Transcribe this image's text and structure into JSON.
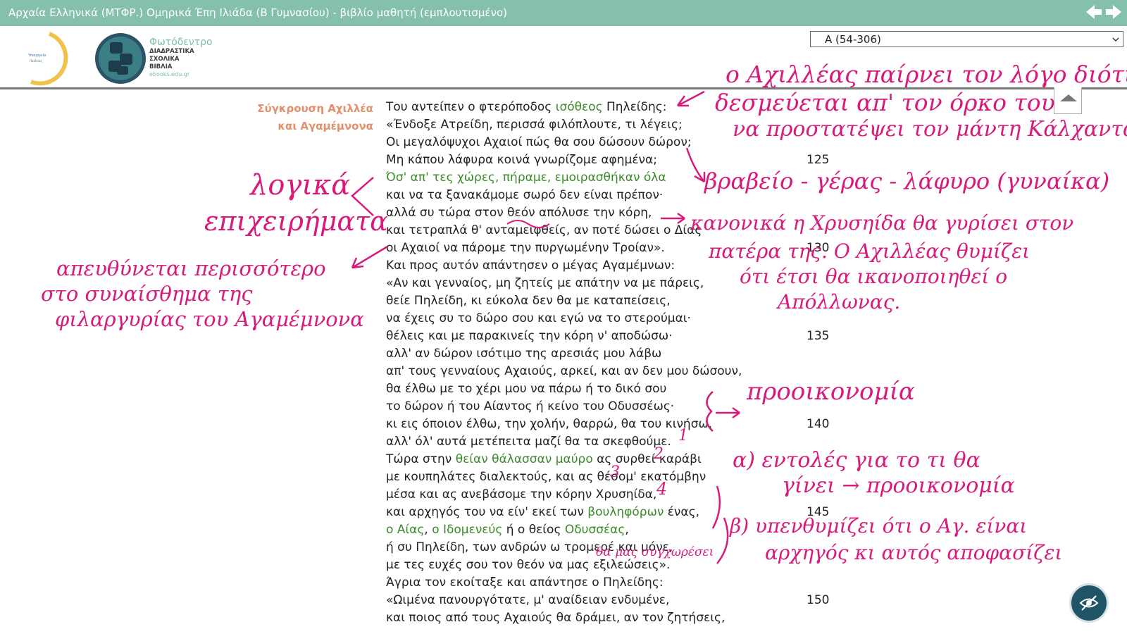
{
  "window": {
    "title": "Αρχαία Ελληνικά (ΜΤΦΡ.) Ομηρικά Έπη Ιλιάδα (Β Γυμνασίου) - βιβλίο μαθητή (εμπλουτισμένο)"
  },
  "header": {
    "brand_name": "Φωτόδεντρο",
    "brand_sub": [
      "ΔΙΑΔΡΑΣΤΙΚΑ",
      "ΣΧΟΛΙΚΑ",
      "ΒΙΒΛΙΑ"
    ],
    "brand_url": "ebooks.edu.gr",
    "selector_value": "Α (54-306)"
  },
  "section_title": [
    "Σύγκρουση Αχιλλέα",
    "και Αγαμέμνονα"
  ],
  "poem": {
    "lines": [
      [
        {
          "t": "Του αντείπεν ο φτερόποδος "
        },
        {
          "t": "ισόθεος",
          "h": 1
        },
        {
          "t": " Πηλείδης:"
        }
      ],
      [
        {
          "t": "«Ένδοξε Ατρείδη, περισσά φιλόπλουτε, τι λέγεις;"
        }
      ],
      [
        {
          "t": "Οι μεγαλόψυχοι Αχαιοί πώς θα σου δώσουν δώρον;"
        }
      ],
      [
        {
          "t": "Μη κάπου λάφυρα κοινά γνωρίζομε αφημένα;"
        }
      ],
      [
        {
          "t": "Όσ' απ' τες χώρες, πήραμε, εμοιρασθήκαν όλα",
          "h": 1
        }
      ],
      [
        {
          "t": "και να τα ξανακάμομε σωρό δεν είναι πρέπον·"
        }
      ],
      [
        {
          "t": "αλλά συ τώρα στον θεόν απόλυσε την κόρη,"
        }
      ],
      [
        {
          "t": "και τετραπλά θ' ανταμειφθείς, αν ποτέ δώσει ο Δίας"
        }
      ],
      [
        {
          "t": "οι Αχαιοί να πάρομε την πυργωμένην Τροίαν»."
        }
      ],
      [
        {
          "t": "Και προς αυτόν απάντησεν ο μέγας Αγαμέμνων:"
        }
      ],
      [
        {
          "t": "«Αν και γενναίος, μη ζητείς με απάτην να με πάρεις,"
        }
      ],
      [
        {
          "t": "θείε Πηλείδη, κι εύκολα δεν θα με καταπείσεις,"
        }
      ],
      [
        {
          "t": "να έχεις συ το δώρο σου και εγώ να το στερούμαι·"
        }
      ],
      [
        {
          "t": "θέλεις και με παρακινείς την κόρη ν' αποδώσω·"
        }
      ],
      [
        {
          "t": "αλλ' αν δώρον ισότιμο της αρεσιάς μου λάβω"
        }
      ],
      [
        {
          "t": "απ' τους γενναίους Αχαιούς, αρκεί, και αν δεν μου δώσουν,"
        }
      ],
      [
        {
          "t": "θα έλθω με το χέρι μου να πάρω ή το δικό σου"
        }
      ],
      [
        {
          "t": "το δώρον ή του Αίαντος ή κείνο του Οδυσσέως·"
        }
      ],
      [
        {
          "t": "κι εις όποιον έλθω, την χολήν, θαρρώ, θα του κινήσω."
        }
      ],
      [
        {
          "t": "αλλ' όλ' αυτά μετέπειτα μαζί θα τα σκεφθούμε."
        }
      ],
      [
        {
          "t": "Τώρα στην "
        },
        {
          "t": "θείαν θάλασσαν μαύρο",
          "h": 1
        },
        {
          "t": " ας συρθεί καράβι"
        }
      ],
      [
        {
          "t": "με κουπηλάτες διαλεκτούς, και ας θέσομ' εκατόμβην"
        }
      ],
      [
        {
          "t": "μέσα και ας ανεβάσομε την κόρην Χρυσηίδα,"
        }
      ],
      [
        {
          "t": "και αρχηγός του να είν' εκεί των "
        },
        {
          "t": "βουληφόρων",
          "h": 1
        },
        {
          "t": " ένας,"
        }
      ],
      [
        {
          "t": "ο Αίας",
          "h": 1
        },
        {
          "t": ", "
        },
        {
          "t": "ο Ιδομενεύς",
          "h": 1
        },
        {
          "t": " ή ο θείος "
        },
        {
          "t": "Οδυσσέας",
          "h": 1
        },
        {
          "t": ","
        }
      ],
      [
        {
          "t": "ή συ Πηλείδη, των ανδρών ω τρομερέ και μόνε,"
        }
      ],
      [
        {
          "t": "με τες ευχές σου τον θεόν να μας εξιλεώσεις»."
        }
      ],
      [
        {
          "t": "Άγρια τον εκοίταξε και απάντησε ο Πηλείδης:"
        }
      ],
      [
        {
          "t": "«Ωιμένα πανουργότατε, μ' αναίδειαν ενδυμένε,"
        }
      ],
      [
        {
          "t": "και ποιος από τους Αχαιούς θα δράμει, αν τον ζητήσεις,"
        }
      ]
    ],
    "line_numbers": [
      {
        "n": "125",
        "row": 3
      },
      {
        "n": "130",
        "row": 8
      },
      {
        "n": "135",
        "row": 13
      },
      {
        "n": "140",
        "row": 18
      },
      {
        "n": "145",
        "row": 23
      },
      {
        "n": "150",
        "row": 28
      }
    ]
  },
  "annotations": {
    "achilles_note": [
      "ο Αχιλλέας παίρνει τον λόγο διότι",
      "δεσμεύεται απ' τον όρκο του",
      "να προστατέψει τον μάντη Κάλχαντα"
    ],
    "prize_note": "βραβείο - γέρας - λάφυρο (γυναίκα)",
    "logic_note": [
      "λογικά",
      "επιχειρήματα"
    ],
    "appeal_note": [
      "απευθύνεται περισσότερο",
      "στο συναίσθημα της",
      "φιλαργυρίας του Αγαμέμνονα"
    ],
    "chryseis_note": [
      "κανονικά η Χρυσηίδα θα γυρίσει στον",
      "πατέρα της. Ο Αχιλλέας θυμίζει",
      "ότι έτσι θα ικανοποιηθεί ο",
      "Απόλλωνας."
    ],
    "foreshadow_note": "προοικονομία",
    "orders_note": [
      "α) εντολές για το τι θα",
      "γίνει → προοικονομία"
    ],
    "reminder_note": [
      "β) υπενθυμίζει ότι ο Αγ. είναι",
      "αρχηγός κι αυτός αποφασίζει"
    ],
    "forgiveness_note": "θα μας συγχωρέσει",
    "order_numbers": [
      "1",
      "2",
      "3",
      "4"
    ]
  },
  "colors": {
    "titlebar": "#85bfae",
    "highlight": "#3a8a2a",
    "section_title": "#e0916b",
    "ink": "#d81b7a"
  }
}
